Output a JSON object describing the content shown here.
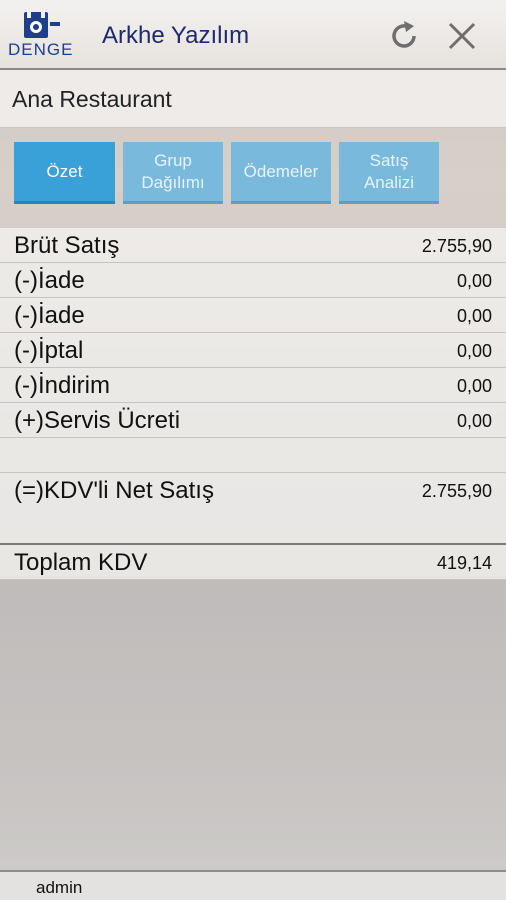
{
  "header": {
    "logo_text": "DENGE",
    "title": "Arkhe Yazılım",
    "refresh_icon": "refresh-icon",
    "close_icon": "close-icon",
    "title_color": "#1e2a70"
  },
  "restaurant": {
    "name": "Ana Restaurant"
  },
  "tabs": [
    {
      "label": "Özet",
      "active": true
    },
    {
      "label": "Grup\nDağılımı",
      "active": false
    },
    {
      "label": "Ödemeler",
      "active": false
    },
    {
      "label": "Satış\nAnalizi",
      "active": false
    }
  ],
  "summary": {
    "rows": [
      {
        "label": "Brüt Satış",
        "value": "2.755,90"
      },
      {
        "label": "(-)İade",
        "value": "0,00"
      },
      {
        "label": "(-)İade",
        "value": "0,00"
      },
      {
        "label": "(-)İptal",
        "value": "0,00"
      },
      {
        "label": "(-)İndirim",
        "value": "0,00"
      },
      {
        "label": "(+)Servis Ücreti",
        "value": "0,00"
      }
    ],
    "net": {
      "label": "(=)KDV'li Net Satış",
      "value": "2.755,90"
    },
    "total_kdv": {
      "label": "Toplam KDV",
      "value": "419,14"
    }
  },
  "footer": {
    "user": "admin"
  },
  "colors": {
    "tab_active": "#3aa0d8",
    "tab_inactive": "#79b9dc"
  }
}
